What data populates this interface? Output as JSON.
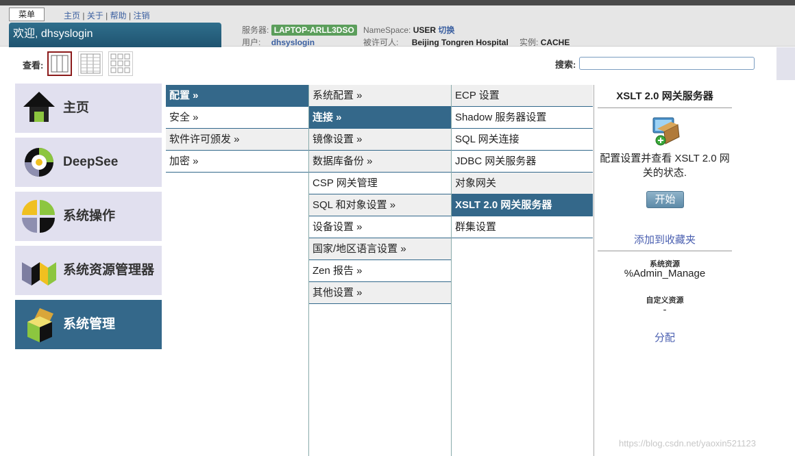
{
  "header": {
    "menu_label": "菜单",
    "links": [
      "主页",
      "关于",
      "帮助",
      "注销"
    ],
    "welcome": "欢迎, dhsyslogin",
    "server_label": "服务器:",
    "server_value": "LAPTOP-ARLL3DSO",
    "namespace_label": "NameSpace:",
    "namespace_value": "USER",
    "switch_label": "切换",
    "user_label": "用户:",
    "user_value": "dhsyslogin",
    "licensee_label": "被许可人:",
    "licensee_value": "Beijing Tongren Hospital",
    "instance_label": "实例:",
    "instance_value": "CACHE"
  },
  "toolbar": {
    "view_label": "查看:",
    "search_label": "搜索:",
    "search_value": ""
  },
  "tiles": [
    {
      "label": "主页",
      "icon": "home-icon",
      "active": false
    },
    {
      "label": "DeepSee",
      "icon": "deepsee-icon",
      "active": false
    },
    {
      "label": "系统操作",
      "icon": "system-operation-icon",
      "active": false
    },
    {
      "label": "系统资源管理器",
      "icon": "system-explorer-icon",
      "active": false
    },
    {
      "label": "系统管理",
      "icon": "system-admin-icon",
      "active": true
    }
  ],
  "column1": [
    "配置 »",
    "安全 »",
    "软件许可颁发 »",
    "加密 »"
  ],
  "column2": [
    "系统配置 »",
    "连接 »",
    "镜像设置 »",
    "数据库备份 »",
    "CSP 网关管理",
    "SQL 和对象设置 »",
    "设备设置 »",
    "国家/地区语言设置 »",
    "Zen 报告 »",
    "其他设置 »"
  ],
  "column3": [
    "ECP 设置",
    "Shadow 服务器设置",
    "SQL 网关连接",
    "JDBC 网关服务器",
    "对象网关",
    "XSLT 2.0 网关服务器",
    "群集设置"
  ],
  "detail": {
    "title": "XSLT 2.0 网关服务器",
    "description": "配置设置并查看 XSLT 2.0 网关的状态.",
    "start_label": "开始",
    "favorite_label": "添加到收藏夹",
    "system_resource_label": "系统资源",
    "system_resource_value": "%Admin_Manage",
    "custom_resource_label": "自定义资源",
    "custom_resource_value": "-",
    "assign_label": "分配"
  },
  "watermark": "https://blog.csdn.net/yaoxin521123",
  "colors": {
    "accent": "#34688a",
    "header_bg": "#e6e6e6",
    "tile_bg": "#e1e0ef",
    "server_badge": "#5b9e5b",
    "link": "#4a5fb0"
  }
}
